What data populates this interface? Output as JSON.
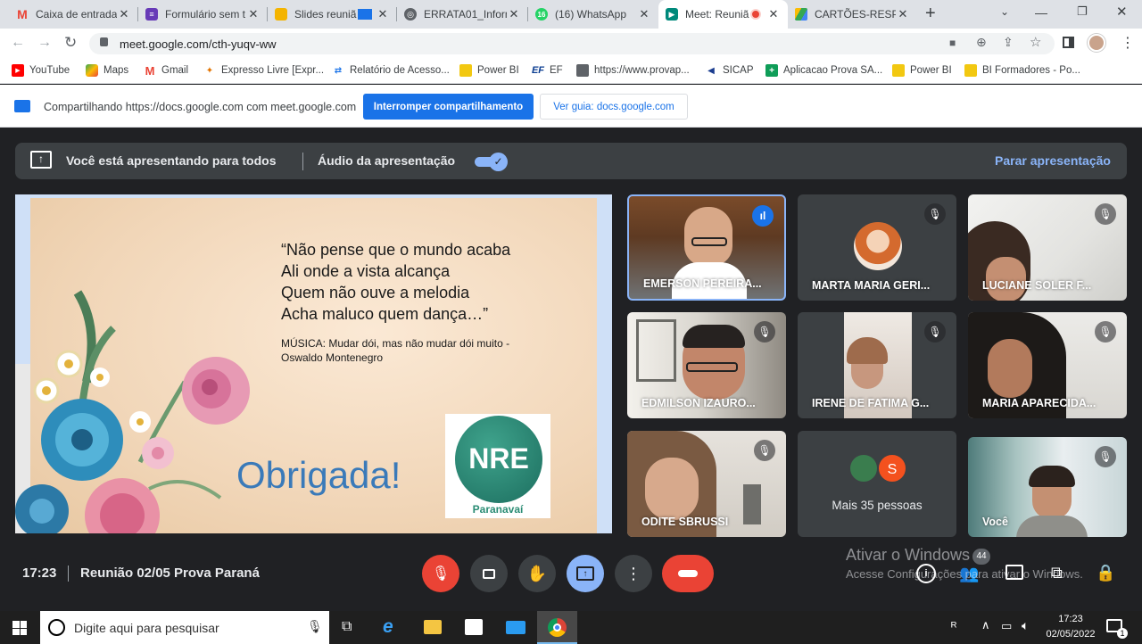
{
  "browser": {
    "tabs": [
      {
        "title": "Caixa de entrada",
        "icon": "gmail-icon",
        "color": "#ea4335"
      },
      {
        "title": "Formulário sem t",
        "icon": "forms-icon",
        "color": "#673ab7"
      },
      {
        "title": "Slides reuniã",
        "icon": "slides-icon",
        "color": "#f4b400"
      },
      {
        "title": "ERRATA01_Inform",
        "icon": "globe-icon",
        "color": "#5f6368"
      },
      {
        "title": "(16) WhatsApp",
        "icon": "whatsapp-icon",
        "color": "#25d366",
        "badge": "16"
      },
      {
        "title": "Meet: Reuniã",
        "icon": "meet-icon",
        "color": "#00897b"
      },
      {
        "title": "CARTÕES-RESPO",
        "icon": "drive-icon",
        "color": "#1e8e3e"
      }
    ],
    "url": "meet.google.com/cth-yuqv-ww",
    "bookmarks": [
      {
        "label": "YouTube",
        "icon": "youtube-icon"
      },
      {
        "label": "Maps",
        "icon": "maps-icon"
      },
      {
        "label": "Gmail",
        "icon": "gmail-icon"
      },
      {
        "label": "Expresso Livre [Expr...",
        "icon": "expresso-icon"
      },
      {
        "label": "Relatório de Acesso...",
        "icon": "report-icon"
      },
      {
        "label": "Power BI",
        "icon": "powerbi-icon"
      },
      {
        "label": "EF",
        "icon": "ef-icon",
        "badge": "EF"
      },
      {
        "label": "https://www.provap...",
        "icon": "provap-icon"
      },
      {
        "label": "SICAP",
        "icon": "sicap-icon"
      },
      {
        "label": "Aplicacao Prova SA...",
        "icon": "plus-green-icon"
      },
      {
        "label": "Power BI",
        "icon": "powerbi-icon"
      },
      {
        "label": "BI Formadores - Po...",
        "icon": "powerbi-icon"
      }
    ]
  },
  "sharing": {
    "text": "Compartilhando https://docs.google.com com meet.google.com",
    "stop_label": "Interromper compartilhamento",
    "view_label": "Ver guia: docs.google.com"
  },
  "presenting": {
    "text": "Você está apresentando para todos",
    "audio_label": "Áudio da apresentação",
    "audio_on": true,
    "stop_label": "Parar apresentação"
  },
  "slide": {
    "quote": [
      "“Não pense que o mundo acaba",
      "Ali onde a vista alcança",
      "Quem não ouve a melodia",
      "Acha maluco quem dança…”"
    ],
    "credit": [
      "MÚSICA: Mudar dói,  mas não mudar dói muito -",
      "Oswaldo Montenegro"
    ],
    "thanks": "Obrigada!",
    "logo_text": "NRE",
    "logo_sub": "Paranavaí"
  },
  "participants": [
    {
      "name": "EMERSON PEREIRA...",
      "speaking": true
    },
    {
      "name": "MARTA MARIA GERI...",
      "muted": true
    },
    {
      "name": "LUCIANE SOLER F...",
      "muted": true
    },
    {
      "name": "EDMILSON IZAURO...",
      "muted": true
    },
    {
      "name": "IRENE DE FATIMA G...",
      "muted": true
    },
    {
      "name": "MARIA APARECIDA...",
      "muted": true
    },
    {
      "name": "ODITE SBRUSSI",
      "muted": true
    },
    {
      "name": "Mais 35 pessoas",
      "avatar_letter": "S"
    },
    {
      "name": "Você",
      "muted": true
    }
  ],
  "meeting": {
    "time": "17:23",
    "title": "Reunião 02/05 Prova Paraná",
    "participants_count": "44"
  },
  "watermark": {
    "line1": "Ativar o Windows",
    "line2": "Acesse Configurações para ativar o Windows."
  },
  "taskbar": {
    "search_placeholder": "Digite aqui para pesquisar",
    "time": "17:23",
    "date": "02/05/2022",
    "notif_count": "1"
  }
}
